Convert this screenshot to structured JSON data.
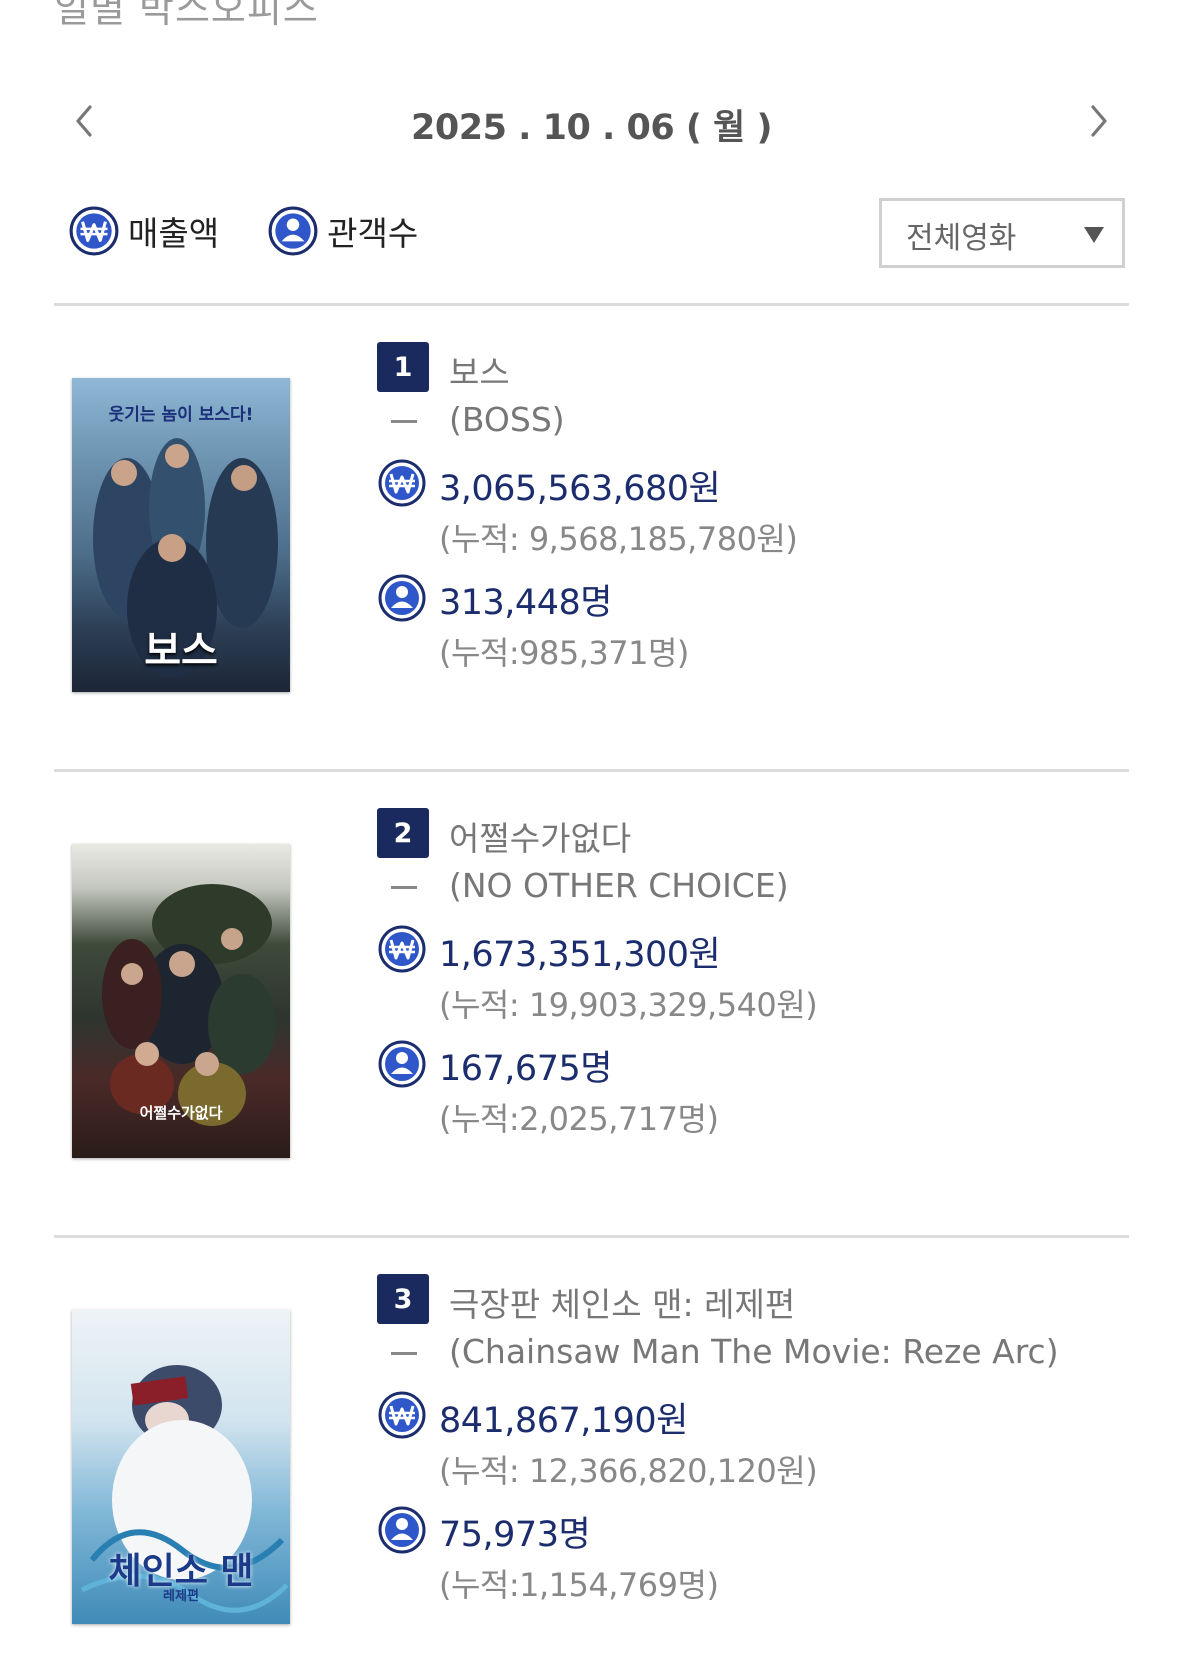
{
  "page": {
    "heading": "일별 박스오피스"
  },
  "date_nav": {
    "date": "2025 . 10 . 06 ( 월 )"
  },
  "toggles": {
    "sales_label": "매출액",
    "audience_label": "관객수"
  },
  "filter": {
    "selected": "전체영화"
  },
  "colors": {
    "navy": "#1b2a5e",
    "accent_blue": "#2f57c9",
    "text_gray": "#777777"
  },
  "movies": [
    {
      "rank": "1",
      "title_ko": "보스",
      "title_en": "(BOSS)",
      "sales": "3,065,563,680원",
      "sales_cumulative": "(누적: 9,568,185,780원)",
      "audience": "313,448명",
      "audience_cumulative": "(누적:985,371명)",
      "poster": {
        "tagline": "웃기는 놈이 보스다!",
        "title": "보스"
      }
    },
    {
      "rank": "2",
      "title_ko": "어쩔수가없다",
      "title_en": "(NO OTHER CHOICE)",
      "sales": "1,673,351,300원",
      "sales_cumulative": "(누적: 19,903,329,540원)",
      "audience": "167,675명",
      "audience_cumulative": "(누적:2,025,717명)",
      "poster": {
        "title": "어쩔수가없다"
      }
    },
    {
      "rank": "3",
      "title_ko": "극장판 체인소 맨: 레제편",
      "title_en": "(Chainsaw Man The Movie: Reze Arc)",
      "sales": "841,867,190원",
      "sales_cumulative": "(누적: 12,366,820,120원)",
      "audience": "75,973명",
      "audience_cumulative": "(누적:1,154,769명)",
      "poster": {
        "title": "체인소 맨",
        "subtitle": "레제편"
      }
    }
  ]
}
